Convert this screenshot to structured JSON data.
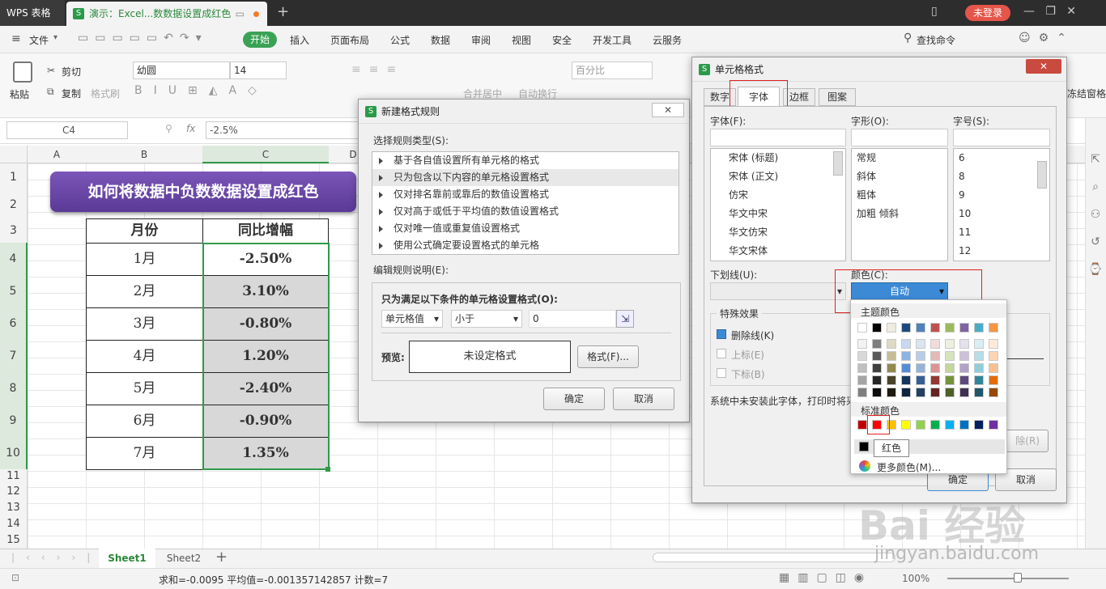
{
  "titlebar": {
    "app": "WPS 表格",
    "doc_tab": "演示：Excel...数数据设置成红色",
    "login": "未登录"
  },
  "menu": {
    "file": "文件",
    "start": "开始",
    "items": [
      "插入",
      "页面布局",
      "公式",
      "数据",
      "审阅",
      "视图",
      "安全",
      "开发工具",
      "云服务"
    ],
    "search": "查找命令"
  },
  "ribbon": {
    "paste": "粘贴",
    "cut": "剪切",
    "copy": "复制",
    "format_painter": "格式刷",
    "font_name": "幼圆",
    "font_size": "14",
    "merge": "合并居中",
    "wrap": "自动换行",
    "number_format": "百分比",
    "freeze": "冻结窗格"
  },
  "formula": {
    "cell_ref": "C4",
    "fx": "fx",
    "value": "-2.5%"
  },
  "grid": {
    "columns": [
      "A",
      "B",
      "C",
      "D"
    ],
    "rows": [
      "1",
      "2",
      "3",
      "4",
      "5",
      "6",
      "7",
      "8",
      "9",
      "10",
      "11",
      "12",
      "13",
      "14",
      "15"
    ],
    "banner": "如何将数据中负数数据设置成红色",
    "header_month": "月份",
    "header_growth": "同比增幅",
    "months": [
      "1月",
      "2月",
      "3月",
      "4月",
      "5月",
      "6月",
      "7月"
    ],
    "growth": [
      "-2.50%",
      "3.10%",
      "-0.80%",
      "1.20%",
      "-2.40%",
      "-0.90%",
      "1.35%"
    ]
  },
  "new_rule_dialog": {
    "title": "新建格式规则",
    "select_type_label": "选择规则类型(S):",
    "rule_types": [
      "基于各自值设置所有单元格的格式",
      "只为包含以下内容的单元格设置格式",
      "仅对排名靠前或靠后的数值设置格式",
      "仅对高于或低于平均值的数值设置格式",
      "仅对唯一值或重复值设置格式",
      "使用公式确定要设置格式的单元格"
    ],
    "edit_label": "编辑规则说明(E):",
    "condition_label": "只为满足以下条件的单元格设置格式(O):",
    "cond_field": "单元格值",
    "cond_op": "小于",
    "cond_value": "0",
    "preview_label": "预览:",
    "preview_text": "未设定格式",
    "format_btn": "格式(F)...",
    "ok": "确定",
    "cancel": "取消"
  },
  "format_dialog": {
    "title": "单元格格式",
    "tabs": [
      "数字",
      "字体",
      "边框",
      "图案"
    ],
    "font_label": "字体(F):",
    "style_label": "字形(O):",
    "size_label": "字号(S):",
    "fonts": [
      "宋体 (标题)",
      "宋体 (正文)",
      "仿宋",
      "华文中宋",
      "华文仿宋",
      "华文宋体"
    ],
    "styles": [
      "常规",
      "斜体",
      "粗体",
      "加粗 倾斜"
    ],
    "sizes": [
      "6",
      "8",
      "9",
      "10",
      "11",
      "12"
    ],
    "underline_label": "下划线(U):",
    "color_label": "颜色(C):",
    "color_value": "自动",
    "effects_label": "特殊效果",
    "strike": "删除线(K)",
    "sup": "上标(E)",
    "sub": "下标(B)",
    "note": "系统中未安装此字体，打印时将采",
    "clear_btn": "除(R)",
    "ok": "确定",
    "cancel": "取消"
  },
  "color_popup": {
    "theme_label": "主题颜色",
    "standard_label": "标准颜色",
    "tooltip": "红色",
    "more": "更多颜色(M)...",
    "theme_top": [
      "#ffffff",
      "#000000",
      "#eeece1",
      "#1f497d",
      "#4f81bd",
      "#c0504d",
      "#9bbb59",
      "#8064a2",
      "#4bacc6",
      "#f79646"
    ],
    "theme_cols": [
      [
        "#f2f2f2",
        "#d8d8d8",
        "#bfbfbf",
        "#a5a5a5",
        "#7f7f7f"
      ],
      [
        "#7f7f7f",
        "#595959",
        "#3f3f3f",
        "#262626",
        "#0c0c0c"
      ],
      [
        "#ddd9c3",
        "#c4bd97",
        "#938953",
        "#494429",
        "#1d1b10"
      ],
      [
        "#c6d9f0",
        "#8db3e2",
        "#548dd4",
        "#17365d",
        "#0f243e"
      ],
      [
        "#dbe5f1",
        "#b8cce4",
        "#95b3d7",
        "#366092",
        "#244061"
      ],
      [
        "#f2dcdb",
        "#e5b9b7",
        "#d99694",
        "#953734",
        "#632423"
      ],
      [
        "#ebf1dd",
        "#d7e3bc",
        "#c3d69b",
        "#76923c",
        "#4f6128"
      ],
      [
        "#e5e0ec",
        "#ccc1d9",
        "#b2a2c7",
        "#5f497a",
        "#3f3151"
      ],
      [
        "#dbeef3",
        "#b7dde8",
        "#92cddc",
        "#31859b",
        "#205867"
      ],
      [
        "#fdeada",
        "#fbd5b5",
        "#fac08f",
        "#e36c09",
        "#974806"
      ]
    ],
    "standard": [
      "#c00000",
      "#ff0000",
      "#ffc000",
      "#ffff00",
      "#92d050",
      "#00b050",
      "#00b0f0",
      "#0070c0",
      "#002060",
      "#7030a0"
    ]
  },
  "sheets": {
    "tabs": [
      "Sheet1",
      "Sheet2"
    ]
  },
  "status": {
    "text": "求和=-0.0095  平均值=-0.001357142857  计数=7",
    "zoom": "100%"
  },
  "watermark": {
    "text": "Bai 经验",
    "url": "jingyan.baidu.com"
  }
}
